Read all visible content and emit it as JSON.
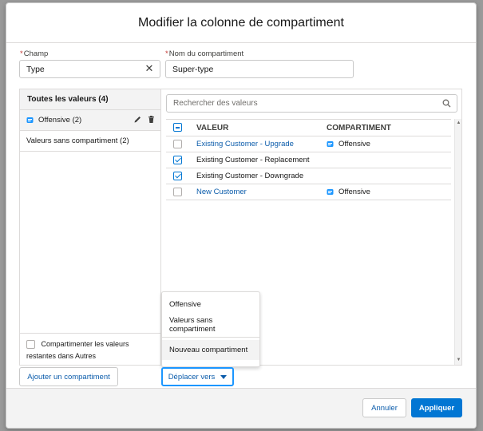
{
  "modal": {
    "title": "Modifier la colonne de compartiment"
  },
  "fields": {
    "champ_label": "Champ",
    "champ_value": "Type",
    "nom_label": "Nom du compartiment",
    "nom_value": "Super-type"
  },
  "left_panel": {
    "header": "Toutes les valeurs (4)",
    "items": [
      {
        "label": "Offensive (2)"
      },
      {
        "label": "Valeurs sans compartiment (2)"
      }
    ],
    "footer_checkbox_label": "Compartimenter les valeurs restantes dans Autres"
  },
  "right_panel": {
    "search_placeholder": "Rechercher des valeurs",
    "columns": [
      "VALEUR",
      "COMPARTIMENT"
    ],
    "rows": [
      {
        "value": "Existing Customer - Upgrade",
        "bucket": "Offensive",
        "checked": false,
        "link": true
      },
      {
        "value": "Existing Customer - Replacement",
        "bucket": "",
        "checked": true,
        "link": false
      },
      {
        "value": "Existing Customer - Downgrade",
        "bucket": "",
        "checked": true,
        "link": false
      },
      {
        "value": "New Customer",
        "bucket": "Offensive",
        "checked": false,
        "link": true
      }
    ]
  },
  "dropdown": {
    "items": [
      "Offensive",
      "Valeurs sans compartiment"
    ],
    "new_item": "Nouveau compartiment"
  },
  "actions": {
    "add_bucket": "Ajouter un compartiment",
    "move_to": "Déplacer vers",
    "cancel": "Annuler",
    "apply": "Appliquer"
  },
  "colors": {
    "brand": "#0176d3",
    "link": "#0b5cab",
    "bucket_icon": "#1b96ff"
  }
}
